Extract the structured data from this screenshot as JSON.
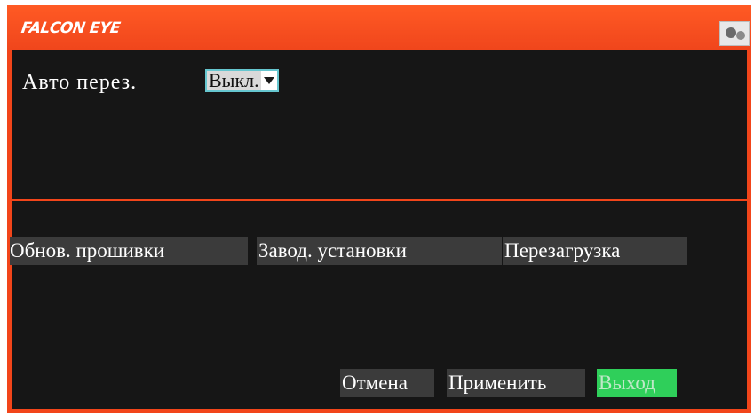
{
  "header": {
    "brand": "FALCON EYE",
    "corner_icon": "camera-icon"
  },
  "settings": {
    "auto_reboot_label": "Авто перез.",
    "auto_reboot_value": "Выкл."
  },
  "actions": {
    "firmware_update": "Обнов. прошивки",
    "factory_defaults": "Завод. установки",
    "reboot": "Перезагрузка"
  },
  "footer": {
    "cancel": "Отмена",
    "apply": "Применить",
    "exit": "Выход"
  },
  "colors": {
    "frame": "#f2451a",
    "panel": "#161616",
    "button": "#3b3b3b",
    "exit_button": "#2fcf5a",
    "select_border": "#66c6cf"
  }
}
